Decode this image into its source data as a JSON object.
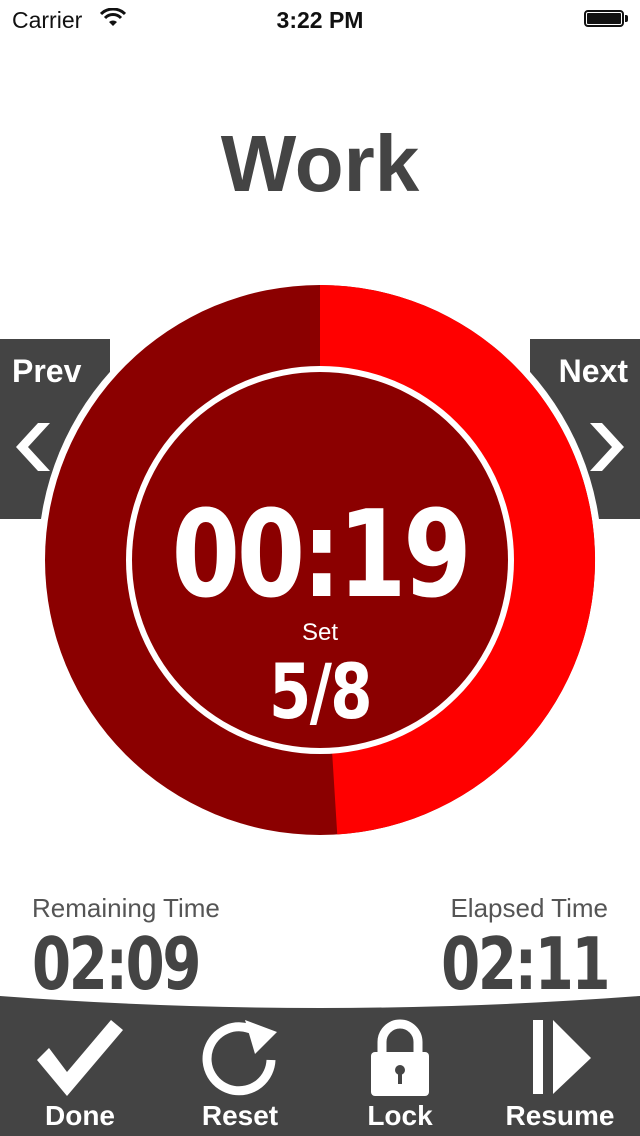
{
  "status_bar": {
    "carrier": "Carrier",
    "time": "3:22 PM"
  },
  "phase": {
    "title": "Work"
  },
  "nav": {
    "prev_label": "Prev",
    "next_label": "Next"
  },
  "timer": {
    "countdown": "00:19",
    "set_label": "Set",
    "set_value": "5/8",
    "progress_fraction": 0.49
  },
  "stats": {
    "remaining_label": "Remaining Time",
    "remaining_value": "02:09",
    "elapsed_label": "Elapsed Time",
    "elapsed_value": "02:11"
  },
  "toolbar": {
    "items": [
      {
        "label": "Done",
        "icon": "checkmark-icon"
      },
      {
        "label": "Reset",
        "icon": "reset-icon"
      },
      {
        "label": "Lock",
        "icon": "lock-icon"
      },
      {
        "label": "Resume",
        "icon": "resume-icon"
      }
    ]
  },
  "colors": {
    "dark_red": "#8b0000",
    "bright_red": "#ff0000",
    "dark_gray": "#444444",
    "background": "#ffffff"
  }
}
